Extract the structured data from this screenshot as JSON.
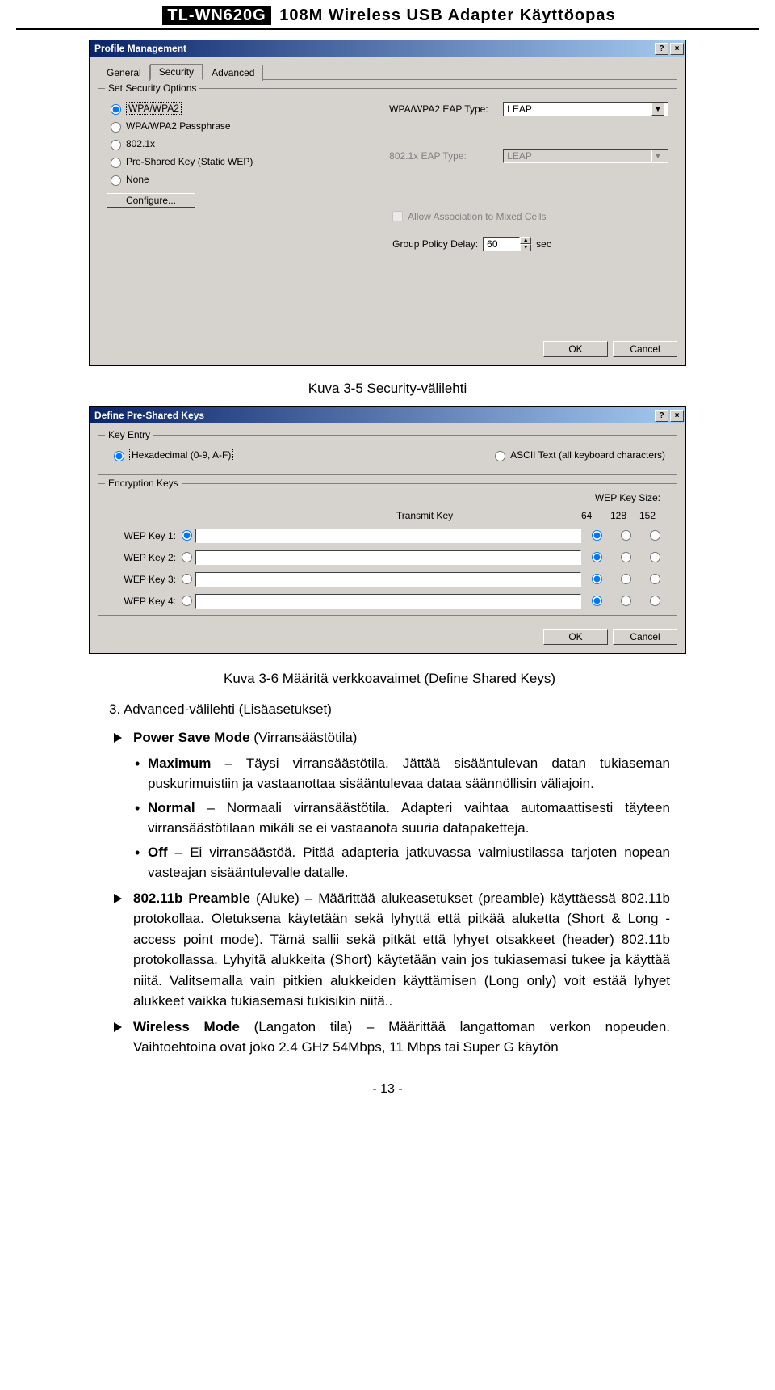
{
  "header": {
    "model": "TL-WN620G",
    "title_rest": "108M Wireless USB Adapter Käyttöopas"
  },
  "dialog1": {
    "title": "Profile Management",
    "help": "?",
    "close": "×",
    "tabs": [
      "General",
      "Security",
      "Advanced"
    ],
    "active_tab": 1,
    "group_security": "Set Security Options",
    "radios": [
      "WPA/WPA2",
      "WPA/WPA2 Passphrase",
      "802.1x",
      "Pre-Shared Key (Static WEP)",
      "None"
    ],
    "eap1_label": "WPA/WPA2 EAP Type:",
    "eap1_value": "LEAP",
    "eap2_label": "802.1x EAP Type:",
    "eap2_value": "LEAP",
    "configure_btn": "Configure...",
    "allow_mixed": "Allow Association to Mixed Cells",
    "group_policy_label": "Group Policy Delay:",
    "group_policy_value": "60",
    "sec_unit": "sec",
    "ok": "OK",
    "cancel": "Cancel"
  },
  "caption1": "Kuva 3-5   Security-välilehti",
  "dialog2": {
    "title": "Define Pre-Shared Keys",
    "help": "?",
    "close": "×",
    "group_keyentry": "Key Entry",
    "hex_label": "Hexadecimal (0-9, A-F)",
    "ascii_label": "ASCII Text (all keyboard characters)",
    "group_enc": "Encryption Keys",
    "transmit_label": "Transmit Key",
    "wep_size_label": "WEP Key Size:",
    "sizes": [
      "64",
      "128",
      "152"
    ],
    "keys": [
      "WEP Key 1:",
      "WEP Key 2:",
      "WEP Key 3:",
      "WEP Key 4:"
    ],
    "ok": "OK",
    "cancel": "Cancel"
  },
  "caption2": "Kuva 3-6   Määritä verkkoavaimet (Define Shared Keys)",
  "article": {
    "l1": "3. Advanced-välilehti (Lisäasetukset)",
    "b1_head": "Power Save Mode",
    "b1_tail": " (Virransäästötila)",
    "s1_head": "Maximum",
    "s1_tail": " – Täysi virransäästötila. Jättää sisääntulevan datan tukiaseman puskurimuistiin ja vastaanottaa sisääntulevaa dataa säännöllisin väliajoin.",
    "s2_head": "Normal",
    "s2_tail": " – Normaali virransäästötila. Adapteri vaihtaa automaattisesti täyteen virransäästötilaan mikäli se ei vastaanota suuria datapaketteja.",
    "s3_head": "Off",
    "s3_tail": " – Ei virransäästöä. Pitää adapteria jatkuvassa valmiustilassa tarjoten nopean vasteajan sisääntulevalle datalle.",
    "b2_head": "802.11b Preamble",
    "b2_tail": " (Aluke) – Määrittää alukeasetukset (preamble) käyttäessä 802.11b protokollaa. Oletuksena käytetään sekä lyhyttä että pitkää aluketta (Short & Long - access point mode). Tämä sallii sekä pitkät että lyhyet otsakkeet (header) 802.11b protokollassa. Lyhyitä alukkeita (Short) käytetään vain jos tukiasemasi tukee ja käyttää niitä. Valitsemalla vain pitkien alukkeiden käyttämisen (Long only) voit estää lyhyet alukkeet vaikka tukiasemasi tukisikin niitä..",
    "b3_head": "Wireless Mode",
    "b3_tail": " (Langaton tila) – Määrittää langattoman verkon nopeuden. Vaihtoehtoina ovat joko 2.4 GHz 54Mbps, 11 Mbps tai Super G käytön"
  },
  "footer": "- 13 -"
}
